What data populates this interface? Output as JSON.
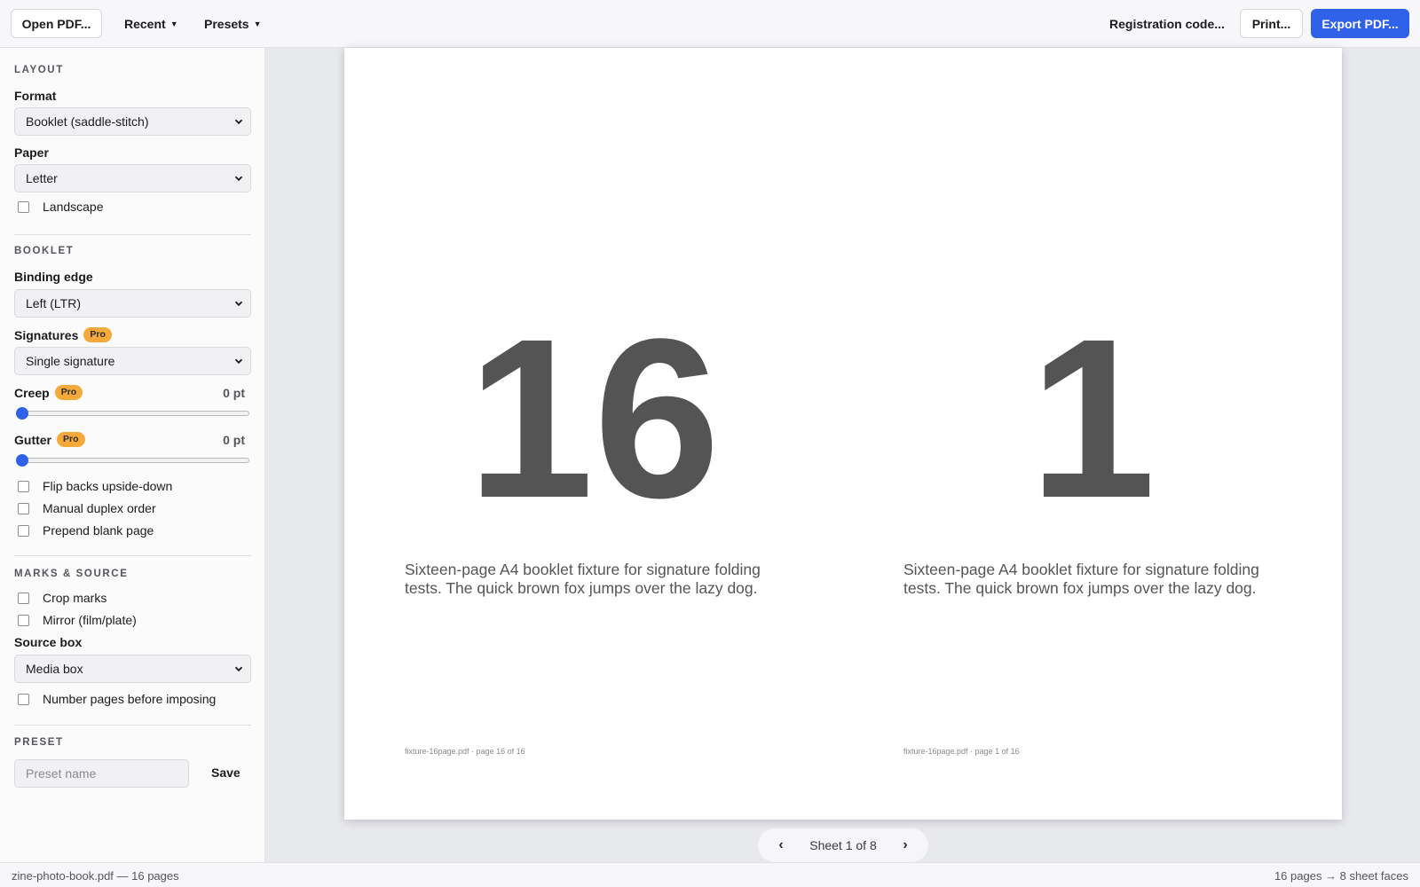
{
  "toolbar": {
    "open_pdf": "Open PDF...",
    "recent": "Recent",
    "presets": "Presets",
    "registration_code": "Registration code...",
    "print": "Print...",
    "export_pdf": "Export PDF..."
  },
  "sidebar": {
    "layout": {
      "heading": "LAYOUT",
      "format_label": "Format",
      "format_value": "Booklet (saddle-stitch)",
      "paper_label": "Paper",
      "paper_value": "Letter",
      "landscape_label": "Landscape",
      "landscape_checked": false
    },
    "booklet": {
      "heading": "BOOKLET",
      "binding_label": "Binding edge",
      "binding_value": "Left (LTR)",
      "signatures_label": "Signatures",
      "signatures_value": "Single signature",
      "creep_label": "Creep",
      "creep_value": "0 pt",
      "creep_level": 0,
      "gutter_label": "Gutter",
      "gutter_value": "0 pt",
      "gutter_level": 0,
      "flip_backs_label": "Flip backs upside-down",
      "manual_duplex_label": "Manual duplex order",
      "prepend_blank_label": "Prepend blank page"
    },
    "marks": {
      "heading": "MARKS & SOURCE",
      "crop_marks_label": "Crop marks",
      "mirror_label": "Mirror (film/plate)",
      "source_box_label": "Source box",
      "source_box_value": "Media box",
      "number_pages_label": "Number pages before imposing"
    },
    "preset": {
      "heading": "PRESET",
      "placeholder": "Preset name",
      "save_label": "Save"
    },
    "pro_badge": "Pro"
  },
  "preview": {
    "left_page": {
      "number": "16",
      "text": "Sixteen-page A4 booklet fixture for signature folding tests. The quick brown fox jumps over the lazy dog.",
      "footer": "fixture-16page.pdf · page 16 of 16"
    },
    "right_page": {
      "number": "1",
      "text": "Sixteen-page A4 booklet fixture for signature folding tests. The quick brown fox jumps over the lazy dog.",
      "footer": "fixture-16page.pdf · page 1 of 16"
    },
    "pager": {
      "prev": "‹",
      "label": "Sheet 1 of 8",
      "next": "›"
    }
  },
  "status": {
    "left": "zine-photo-book.pdf — 16 pages",
    "right": "16 pages → 8 sheet faces"
  },
  "colors": {
    "accent": "#2f62e8",
    "pro_badge": "#f4a93a"
  }
}
